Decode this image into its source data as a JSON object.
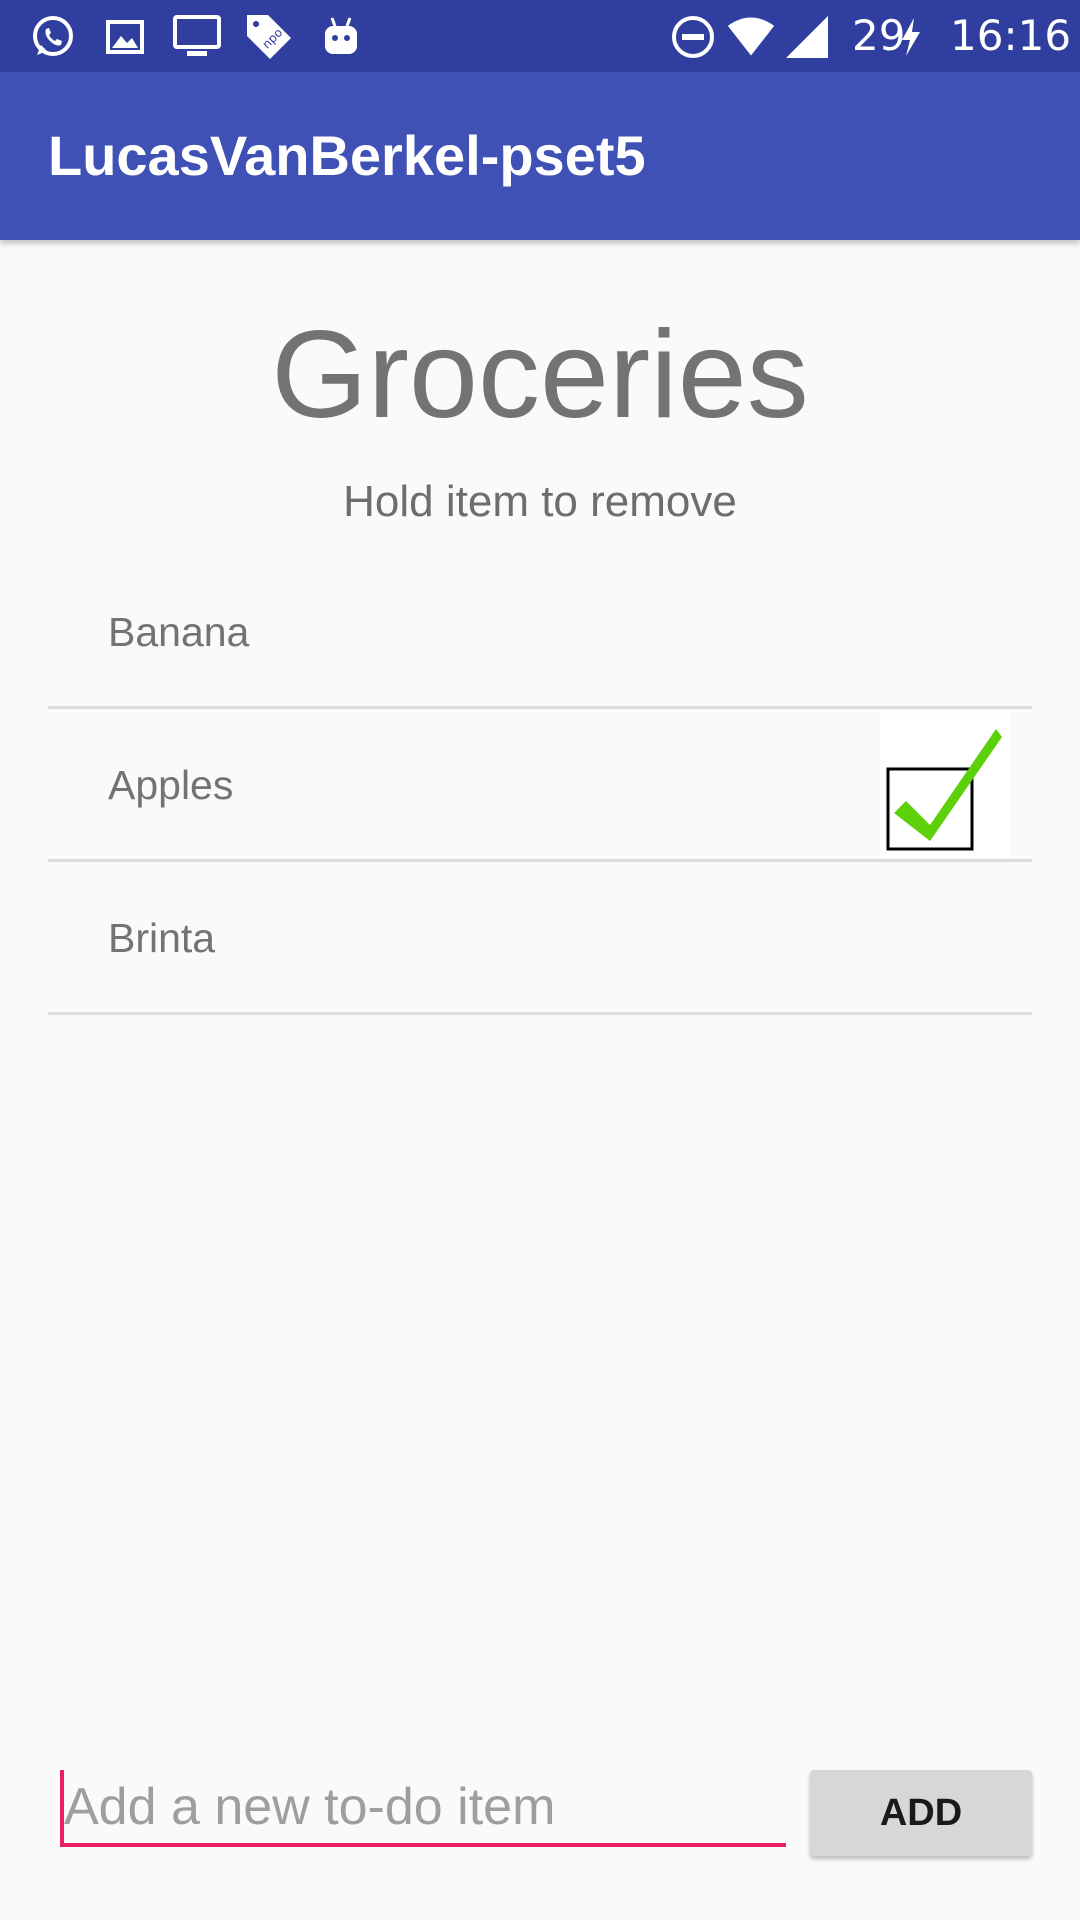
{
  "status_bar": {
    "left_icons": [
      "whatsapp-icon",
      "image-icon",
      "tv-icon",
      "npo-tag-icon",
      "android-icon"
    ],
    "right_icons": [
      "do-not-disturb-icon",
      "wifi-icon",
      "cell-signal-icon",
      "charging-bolt-icon"
    ],
    "battery_level": "29",
    "time": "16:16"
  },
  "app_bar": {
    "title": "LucasVanBerkel-pset5",
    "color": "#3f51b5",
    "status_color": "#303f9f"
  },
  "main": {
    "heading": "Groceries",
    "subheading": "Hold item to remove",
    "items": [
      {
        "label": "Banana",
        "checked": false
      },
      {
        "label": "Apples",
        "checked": true
      },
      {
        "label": "Brinta",
        "checked": false
      }
    ]
  },
  "input": {
    "placeholder": "Add a new to-do item",
    "value": "",
    "accent": "#e91e63"
  },
  "add_button": {
    "label": "ADD"
  }
}
